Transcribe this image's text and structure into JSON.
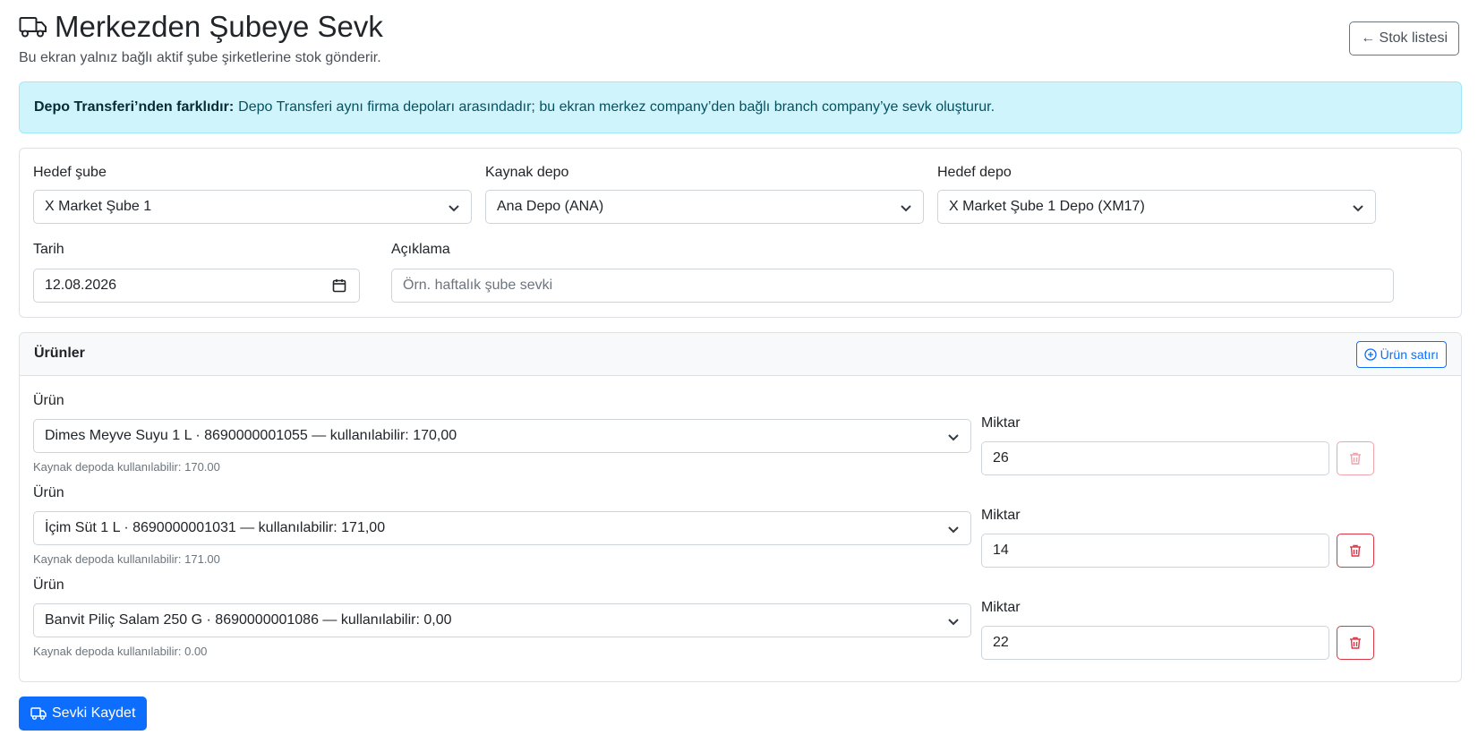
{
  "header": {
    "title": "Merkezden Şubeye Sevk",
    "subtitle": "Bu ekran yalnız bağlı aktif şube şirketlerine stok gönderir.",
    "back_label": "← Stok listesi"
  },
  "alert": {
    "strong": "Depo Transferi’nden farklıdır:",
    "text": "Depo Transferi aynı firma depoları arasındadır; bu ekran merkez company’den bağlı branch company’ye sevk oluşturur."
  },
  "form": {
    "target_branch": {
      "label": "Hedef şube",
      "value": "X Market Şube 1"
    },
    "source_depot": {
      "label": "Kaynak depo",
      "value": "Ana Depo (ANA)"
    },
    "target_depot": {
      "label": "Hedef depo",
      "value": "X Market Şube 1 Depo (XM17)"
    },
    "date": {
      "label": "Tarih",
      "value": "12.08.2026"
    },
    "description": {
      "label": "Açıklama",
      "placeholder": "Örn. haftalık şube sevki",
      "value": ""
    }
  },
  "products": {
    "title": "Ürünler",
    "add_label": "Ürün satırı",
    "rows": [
      {
        "product_label": "Ürün",
        "product": "Dimes Meyve Suyu 1 L · 8690000001055 — kullanılabilir: 170,00",
        "hint": "Kaynak depoda kullanılabilir: 170.00",
        "qty_label": "Miktar",
        "qty": "26"
      },
      {
        "product_label": "Ürün",
        "product": "İçim Süt 1 L · 8690000001031 — kullanılabilir: 171,00",
        "hint": "Kaynak depoda kullanılabilir: 171.00",
        "qty_label": "Miktar",
        "qty": "14"
      },
      {
        "product_label": "Ürün",
        "product": "Banvit Piliç Salam 250 G · 8690000001086 — kullanılabilir: 0,00",
        "hint": "Kaynak depoda kullanılabilir: 0.00",
        "qty_label": "Miktar",
        "qty": "22"
      }
    ]
  },
  "save_label": "Sevki Kaydet",
  "colors": {
    "primary": "#0d6efd",
    "danger": "#dc3545",
    "info_bg": "#cff4fc"
  }
}
